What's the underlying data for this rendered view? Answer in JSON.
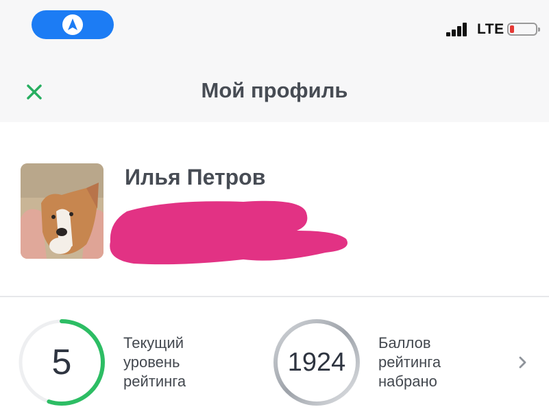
{
  "status_bar": {
    "network": "LTE",
    "battery": "low",
    "colors": {
      "nav_pill": "#1c7cf4",
      "battery_low": "#e53935"
    },
    "icons": [
      "navigation-arrow-icon",
      "signal-bars-icon",
      "battery-icon"
    ]
  },
  "header": {
    "title": "Мой профиль",
    "close_icon": "close-icon",
    "accent": "#27ae60"
  },
  "profile": {
    "name": "Илья Петров",
    "avatar_icon": "avatar-photo-dog",
    "subtitle_redacted": true
  },
  "stats": {
    "level": {
      "value": "5",
      "label": "Текущий\nуровень\nрейтинга",
      "progress": 0.55,
      "ring_color": "#2dbd64"
    },
    "points": {
      "value": "1924",
      "label": "Баллов\nрейтинга\nнабрано",
      "ring_color": "#a9adb3"
    },
    "more_icon": "chevron-right-icon"
  }
}
